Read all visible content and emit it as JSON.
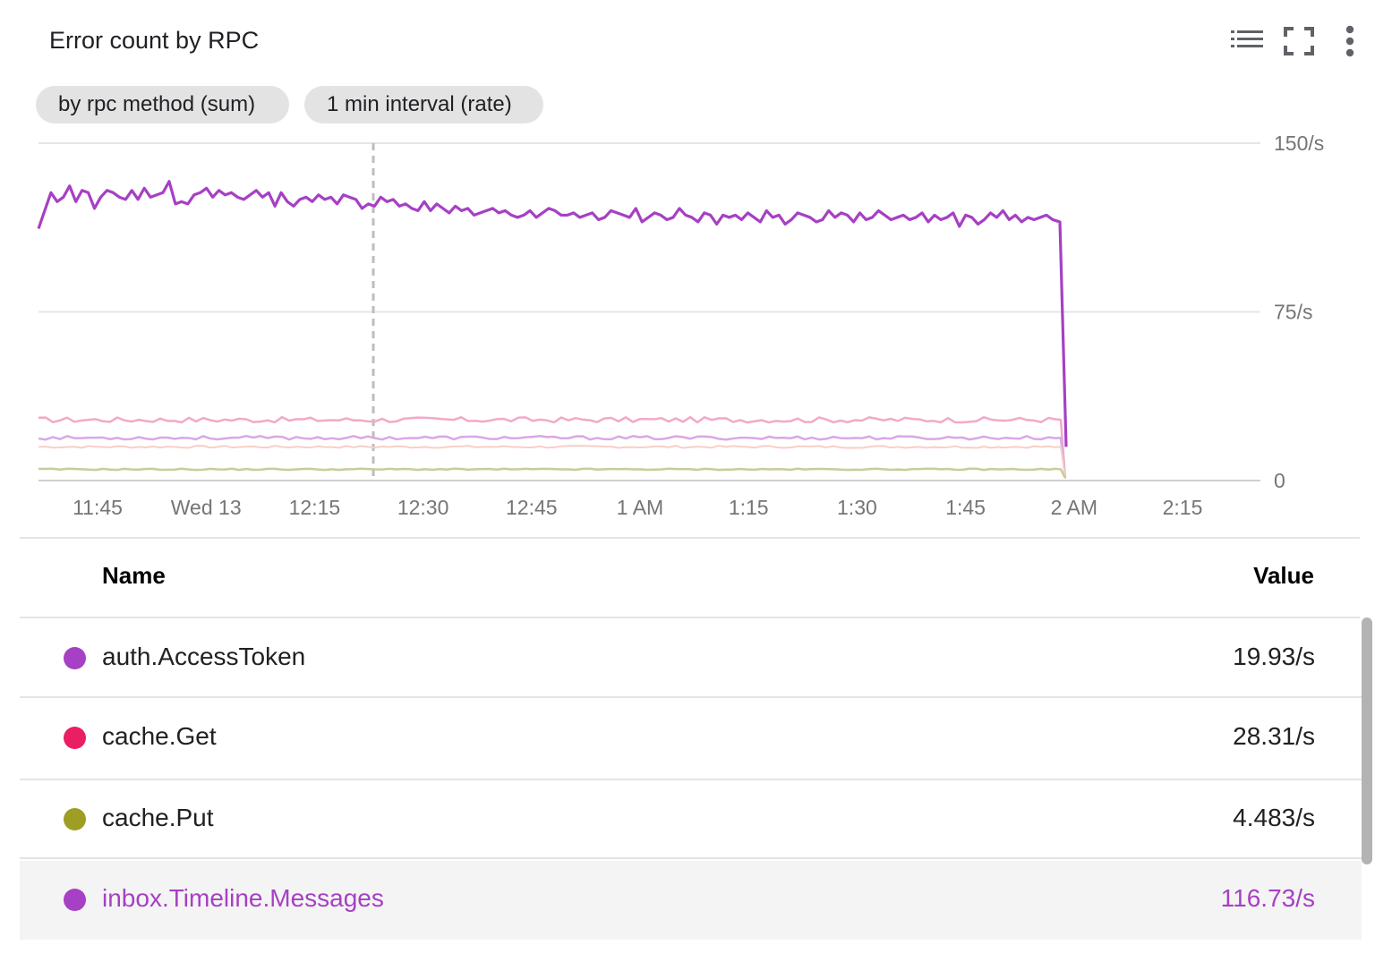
{
  "panel": {
    "title": "Error count by RPC",
    "icons": [
      "legend-list-icon",
      "fullscreen-icon",
      "more-vert-icon"
    ]
  },
  "chips": [
    {
      "label": "by rpc method (sum)"
    },
    {
      "label": "1 min interval (rate)"
    }
  ],
  "chart_data": {
    "type": "line",
    "x_tick_labels": [
      "11:45",
      "Wed 13",
      "12:15",
      "12:30",
      "12:45",
      "1 AM",
      "1:15",
      "1:30",
      "1:45",
      "2 AM",
      "2:15"
    ],
    "y_tick_labels": [
      "150/s",
      "75/s",
      "0"
    ],
    "ylim": [
      0,
      150
    ],
    "x_minutes_range": [
      -24,
      94
    ],
    "cursor_at_minutes": 38,
    "grid": true,
    "series": [
      {
        "name": "inbox.Timeline.Messages",
        "color": "#a640c4",
        "minutes": [
          -27.3,
          -24,
          -21,
          -19.5,
          -18,
          -17,
          -16,
          -15,
          -14,
          -13,
          -12,
          -10.5,
          -9,
          -8,
          -7,
          -6,
          -4,
          -2,
          -1,
          0,
          1,
          2,
          3,
          4,
          5,
          6,
          7,
          8,
          9,
          10,
          11,
          12,
          13,
          14,
          15,
          16,
          17,
          18,
          19,
          20,
          21,
          22,
          23,
          24,
          25,
          26,
          27,
          28,
          29,
          30,
          31,
          32,
          33,
          34,
          35,
          36,
          37,
          38,
          39,
          40,
          41,
          42,
          43,
          44,
          45,
          46,
          47,
          48,
          49,
          50,
          51,
          52,
          53,
          54,
          55,
          56,
          57,
          58,
          59,
          60,
          61,
          62,
          63,
          64,
          65,
          66,
          67,
          68,
          69,
          70,
          71,
          72,
          73,
          74,
          75,
          76,
          77,
          78,
          79,
          80,
          81,
          82,
          83,
          84,
          85,
          86,
          87,
          88,
          89,
          90,
          91,
          92,
          93,
          94,
          95,
          96,
          97,
          98,
          99,
          100,
          101,
          102,
          103,
          104,
          105,
          106,
          107,
          108,
          109,
          110,
          111,
          112,
          113,
          114,
          115,
          116,
          117,
          118,
          119,
          120,
          121,
          122,
          123,
          124,
          125,
          126,
          127,
          128,
          129,
          130,
          131,
          132,
          133,
          134,
          135,
          136,
          137,
          138,
          139,
          140,
          141,
          142,
          143,
          144,
          145,
          145.3,
          145.8
        ],
        "values": [
          112,
          120,
          128,
          124,
          126,
          131,
          124,
          129,
          128,
          121,
          126,
          129,
          128,
          126,
          125,
          129,
          125,
          130,
          126,
          127,
          128,
          133,
          123,
          124,
          123,
          127,
          128,
          130,
          126,
          129,
          127,
          128,
          126,
          125,
          127,
          129,
          126,
          128,
          122,
          128,
          124,
          122,
          125,
          126,
          124,
          127,
          125,
          126,
          123,
          127,
          126,
          125,
          121,
          123,
          122,
          126,
          124,
          125,
          122,
          123,
          121,
          120,
          124,
          120,
          123,
          121,
          119,
          122,
          120,
          121,
          118,
          119,
          120,
          121,
          119,
          120,
          118,
          117,
          118,
          120,
          117,
          119,
          121,
          120,
          118,
          118,
          119,
          117,
          118,
          119,
          116,
          117,
          120,
          119,
          118,
          117,
          121,
          115,
          117,
          119,
          118,
          116,
          117,
          121,
          118,
          117,
          115,
          119,
          118,
          114,
          118,
          117,
          118,
          116,
          119,
          117,
          115,
          120,
          117,
          118,
          114,
          116,
          119,
          118,
          117,
          115,
          116,
          120,
          117,
          119,
          118,
          115,
          119,
          116,
          117,
          120,
          118,
          116,
          117,
          118,
          116,
          117,
          119,
          115,
          118,
          116,
          117,
          119,
          113,
          118,
          117,
          114,
          116,
          119,
          117,
          120,
          116,
          118,
          115,
          117,
          116,
          117,
          118,
          116,
          115,
          15
        ]
      },
      {
        "name": "cache.Get",
        "color": "#f2a9c8",
        "values_note": "flat series around 27/s",
        "level": 27
      },
      {
        "name": "auth.AccessToken",
        "color": "#d9a8e6",
        "level": 19
      },
      {
        "name": "cache.Put",
        "color": "#c9cc9a",
        "level": 5
      }
    ]
  },
  "table": {
    "headers": {
      "name": "Name",
      "value": "Value"
    },
    "rows": [
      {
        "name": "auth.AccessToken",
        "value": "19.93/s",
        "color": "#a640c4",
        "selected": false
      },
      {
        "name": "cache.Get",
        "value": "28.31/s",
        "color": "#e91e63",
        "selected": false
      },
      {
        "name": "cache.Put",
        "value": "4.483/s",
        "color": "#9e9d24",
        "selected": false
      },
      {
        "name": "inbox.Timeline.Messages",
        "value": "116.73/s",
        "color": "#a640c4",
        "selected": true
      }
    ]
  }
}
